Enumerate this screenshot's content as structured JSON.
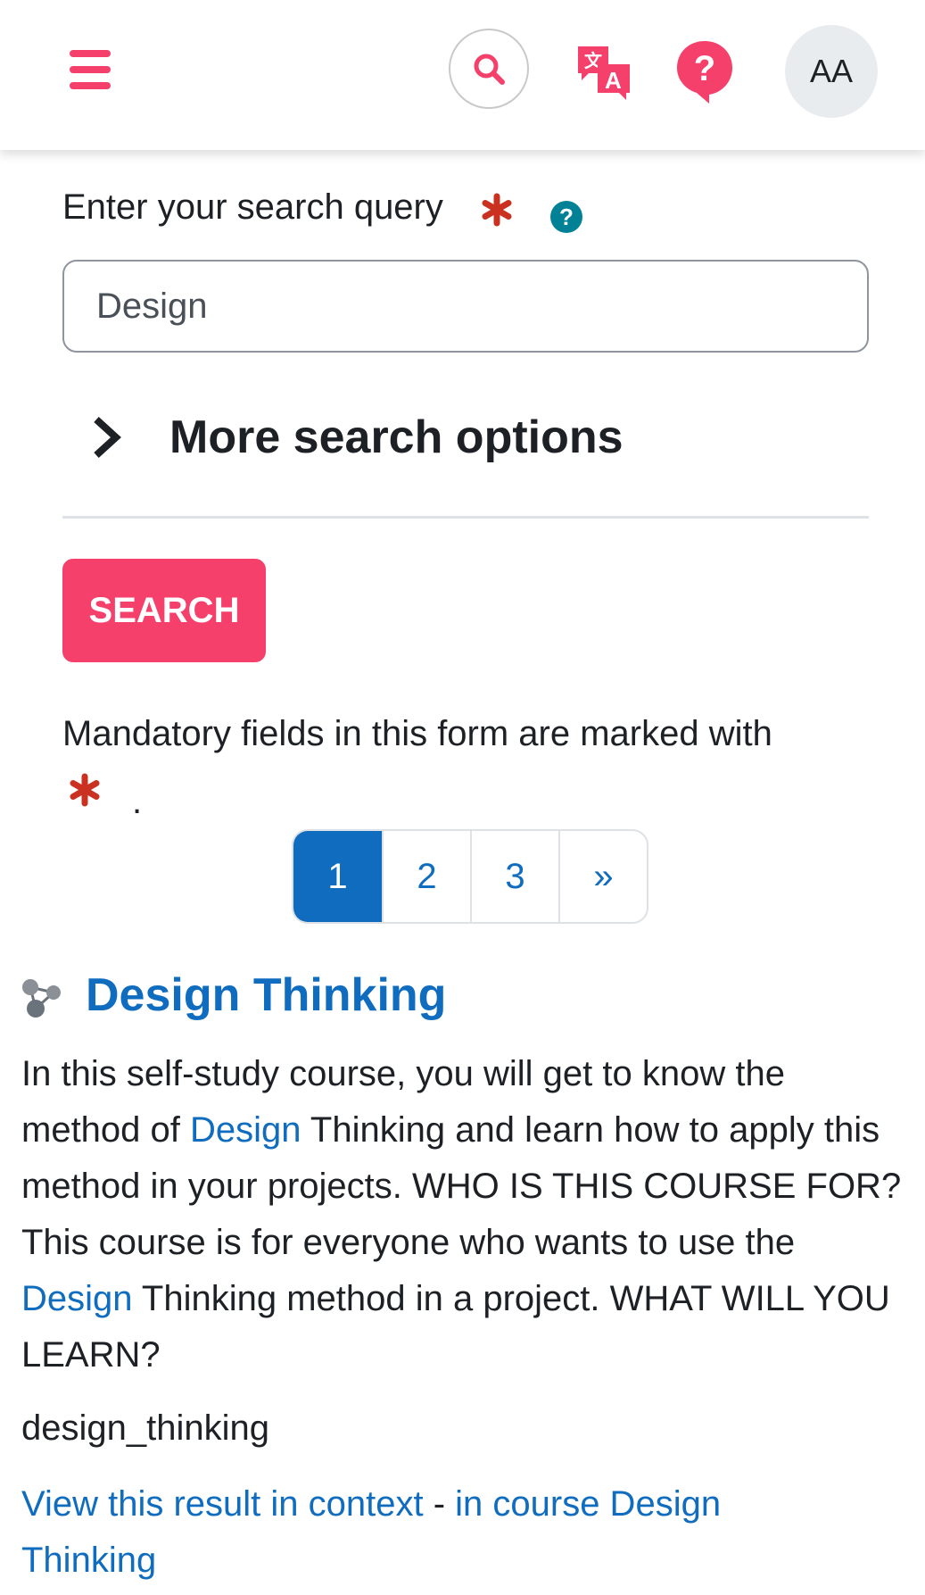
{
  "header": {
    "menu_icon": "hamburger-icon",
    "search_icon": "search-icon",
    "language_icon": "translate-icon",
    "help_icon": "help-icon",
    "avatar_initials": "AA",
    "accent_color": "#f5406c"
  },
  "form": {
    "query_label": "Enter your search query",
    "required_icon": "asterisk-icon",
    "help_icon": "question-circle-icon",
    "query_value": "Design",
    "more_options_label": "More search options",
    "search_button": "SEARCH",
    "mandatory_note": "Mandatory fields in this form are marked with",
    "mandatory_suffix": "."
  },
  "pagination": {
    "pages": [
      "1",
      "2",
      "3"
    ],
    "next": "»",
    "active_page": "1"
  },
  "result": {
    "icon": "course-icon",
    "title": "Design Thinking",
    "desc": {
      "p1": "In this self-study course, you will get to know the method of ",
      "h1": "Design",
      "p2": " Thinking and learn how to apply this method in your projects. WHO IS THIS COURSE FOR? This course is for everyone who wants to use the ",
      "h2": "Design",
      "p3": " Thinking method in a project. WHAT WILL YOU LEARN?"
    },
    "shortname": "design_thinking",
    "view_link": "View this result in context",
    "separator": " - ",
    "course_link": "in course Design Thinking"
  },
  "colors": {
    "link": "#0f6cbf",
    "required": "#ca3120",
    "help": "#008196"
  }
}
